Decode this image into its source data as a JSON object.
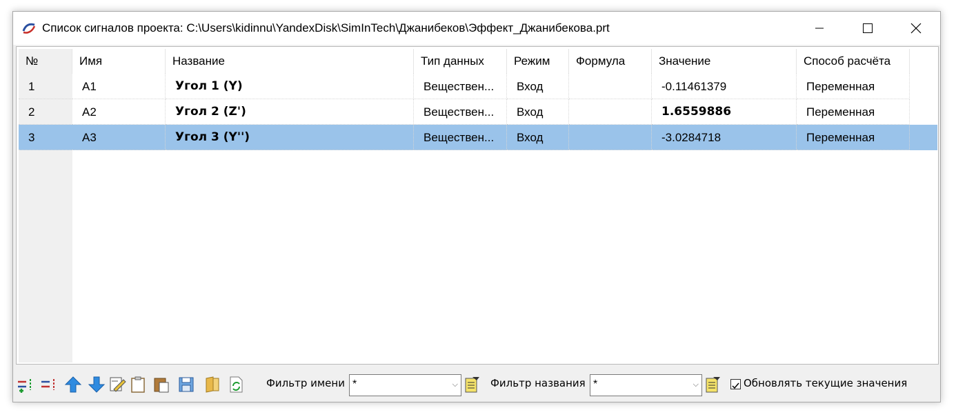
{
  "window": {
    "title": "Список сигналов проекта: C:\\Users\\kidinnu\\YandexDisk\\SimInTech\\Джанибеков\\Эффект_Джанибекова.prt"
  },
  "table": {
    "columns": [
      "№",
      "Имя",
      "Название",
      "Тип данных",
      "Режим",
      "Формула",
      "Значение",
      "Способ расчёта"
    ],
    "rows": [
      {
        "num": "1",
        "name": "A1",
        "title": "Угол 1 (Y)",
        "type": "Веществен...",
        "mode": "Вход",
        "formula": "",
        "value": "-0.11461379",
        "calc": "Переменная"
      },
      {
        "num": "2",
        "name": "A2",
        "title": "Угол 2 (Z')",
        "type": "Веществен...",
        "mode": "Вход",
        "formula": "",
        "value": "1.6559886",
        "calc": "Переменная"
      },
      {
        "num": "3",
        "name": "A3",
        "title": "Угол 3 (Y'')",
        "type": "Веществен...",
        "mode": "Вход",
        "formula": "",
        "value": "-3.0284718",
        "calc": "Переменная"
      }
    ],
    "selected_row": 3,
    "selection_color": "#9ac3ea"
  },
  "toolbar": {
    "icons": [
      "add-signal-icon",
      "remove-signal-icon",
      "move-up-icon",
      "move-down-icon",
      "edit-icon",
      "clipboard-icon",
      "paste-icon",
      "save-icon",
      "folder-icon",
      "refresh-icon"
    ],
    "name_filter_label": "Фильтр имени",
    "name_filter_value": "*",
    "title_filter_label": "Фильтр названия",
    "title_filter_value": "*",
    "update_values_label": "Обновлять текущие значения",
    "update_values_checked": true
  }
}
